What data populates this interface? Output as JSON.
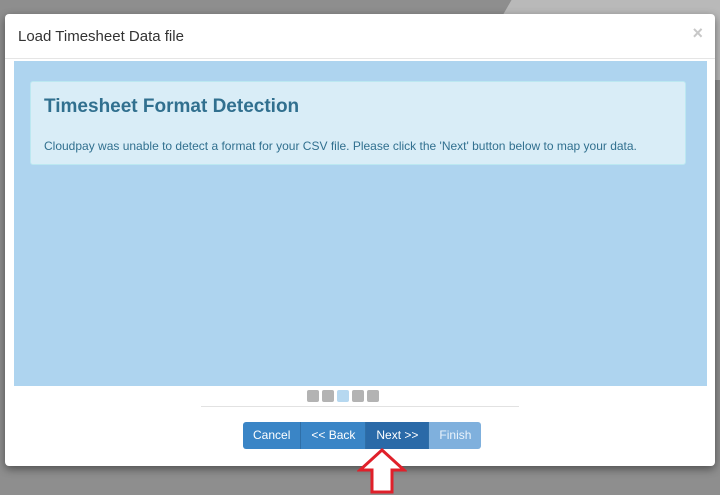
{
  "dialog": {
    "title": "Load Timesheet Data file",
    "close_label": "×"
  },
  "alert": {
    "heading": "Timesheet Format Detection",
    "message": "Cloudpay was unable to detect a format for your CSV file. Please click the 'Next' button below to map your data."
  },
  "steps": {
    "count": 5,
    "current": 3
  },
  "buttons": {
    "cancel": "Cancel",
    "back": "<< Back",
    "next": "Next >>",
    "finish": "Finish"
  },
  "colors": {
    "content_bg": "#aed4ef",
    "alert_bg": "#d9edf7",
    "alert_text": "#31708f",
    "button": "#3a85c6",
    "arrow": "#e0202a"
  }
}
